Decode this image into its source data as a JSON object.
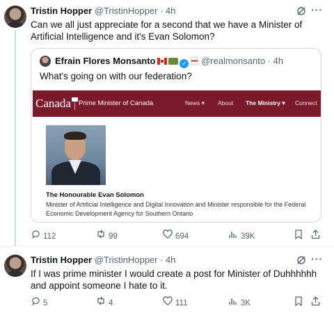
{
  "tweets": [
    {
      "name": "Tristin Hopper",
      "handle": "@TristinHopper · 4h",
      "text": "Can we all just appreciate for a second that we have a Minister of Artificial Intelligence and it's Evan Solomon?",
      "quote": {
        "name": "Efrain Flores Monsanto",
        "handle": "@realmonsanto · 4h",
        "text": "What's going on with our federation?",
        "site": {
          "logo": "Canada",
          "title": "Prime Minister of Canada",
          "nav": [
            "News ▾",
            "About",
            "The Ministry ▾",
            "Connect"
          ],
          "person_name": "The Honourable Evan Solomon",
          "person_role": "Minister of Artificial Intelligence and Digital Innovation and Minister responsible for the Federal Economic Development Agency for Southern Ontario"
        }
      },
      "stats": {
        "replies": "112",
        "reposts": "99",
        "likes": "694",
        "views": "39K"
      }
    },
    {
      "name": "Tristin Hopper",
      "handle": "@TristinHopper · 4h",
      "text": "If I was prime minister I would create a post for Minister of Duhhhhhh and appoint someone I hate to it.",
      "stats": {
        "replies": "5",
        "reposts": "4",
        "likes": "111",
        "views": "3K"
      }
    }
  ],
  "icons": {
    "reply": "reply-icon",
    "repost": "repost-icon",
    "like": "heart-icon",
    "views": "views-icon",
    "bookmark": "bookmark-icon",
    "share": "share-icon",
    "grok": "grok-icon",
    "more": "more-icon"
  },
  "colors": {
    "accent": "#1d9bf0",
    "muted": "#536471",
    "canada_red": "#7a1a2a"
  }
}
